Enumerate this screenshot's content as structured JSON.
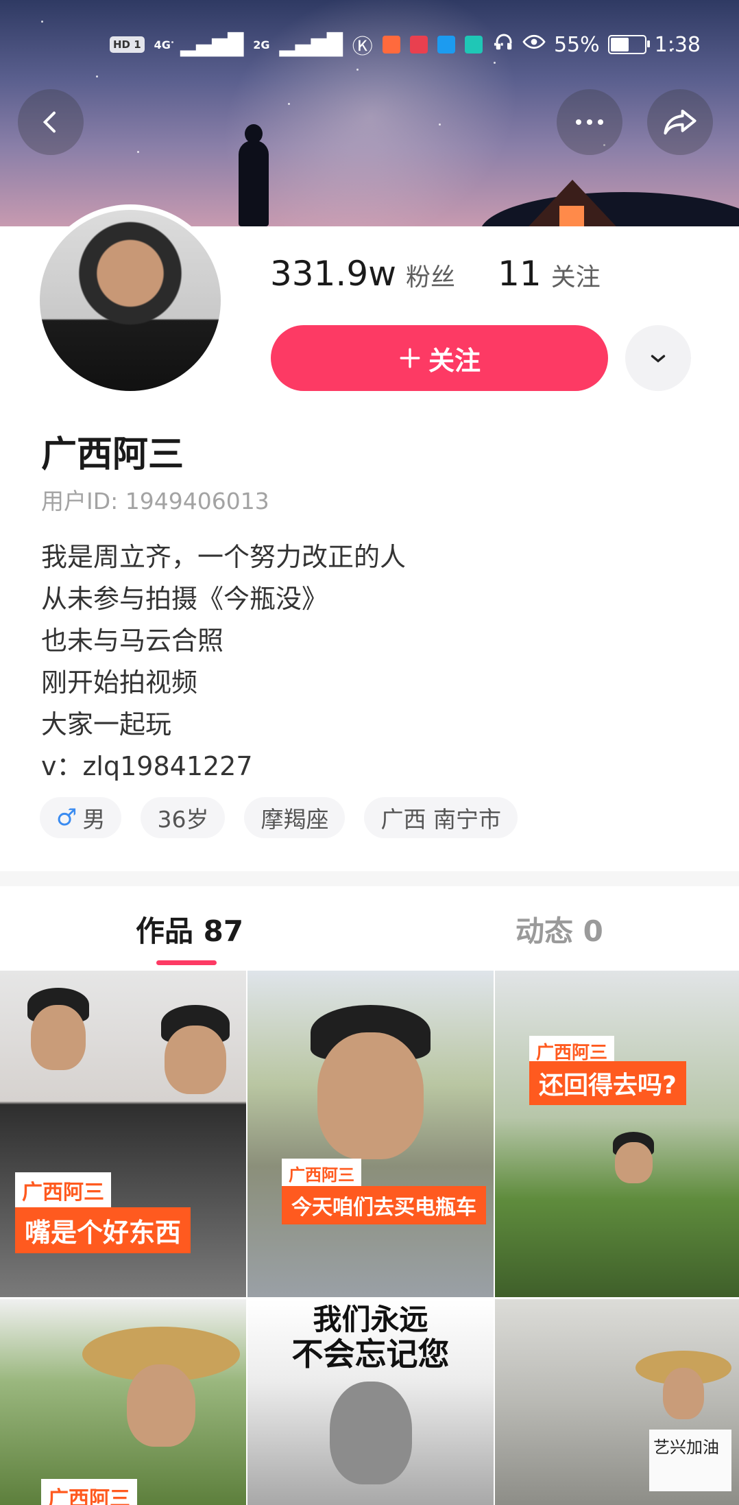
{
  "status_bar": {
    "left_chips": [
      "HD 1",
      "4G",
      "2G"
    ],
    "battery_percent": "55%",
    "battery_level": 0.55,
    "time": "1:38"
  },
  "nav": {
    "back_icon": "chevron-left-icon",
    "more_icon": "more-dots-icon",
    "share_icon": "share-arrow-icon"
  },
  "profile": {
    "followers_count": "331.9w",
    "followers_label": "粉丝",
    "following_count": "11",
    "following_label": "关注",
    "follow_button_label": "关注",
    "name": "广西阿三",
    "user_id": "用户ID: 1949406013",
    "bio": [
      "我是周立齐，一个努力改正的人",
      "从未参与拍摄《今瓶没》",
      "也未与马云合照",
      "刚开始拍视频",
      "大家一起玩",
      "v：zlq19841227"
    ],
    "tags": {
      "gender_symbol": "♂",
      "gender": "男",
      "age": "36岁",
      "zodiac": "摩羯座",
      "location": "广西 南宁市"
    }
  },
  "tabs": {
    "works": "作品 87",
    "dynamic": "动态 0"
  },
  "colors": {
    "accent": "#fd3a64",
    "caption_orange": "#ff5a1f"
  },
  "videos": [
    {
      "brand": "广西阿三",
      "caption": "嘴是个好东西"
    },
    {
      "brand": "广西阿三",
      "caption": "今天咱们去买电瓶车"
    },
    {
      "brand": "广西阿三",
      "caption": "还回得去吗?"
    },
    {
      "brand": "广西阿三",
      "caption": ""
    },
    {
      "headline_1": "我们永远",
      "headline_2": "不会忘记您"
    },
    {
      "sign_text": "艺兴加油"
    }
  ]
}
